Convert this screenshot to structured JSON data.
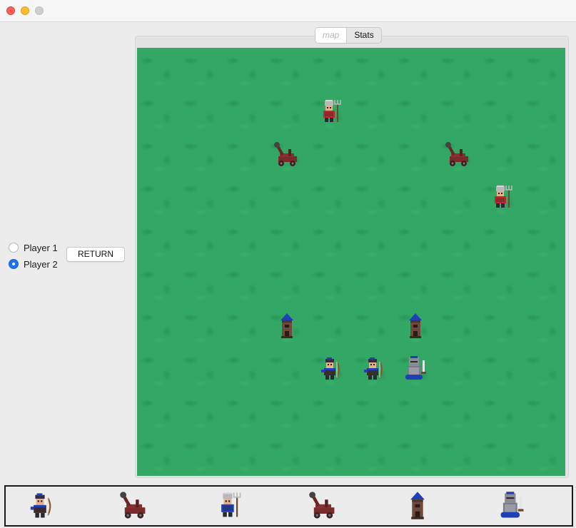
{
  "window": {
    "controls": [
      "close",
      "minimize",
      "maximize"
    ]
  },
  "sidebar": {
    "players": [
      {
        "label": "Player 1",
        "selected": false
      },
      {
        "label": "Player 2",
        "selected": true
      }
    ],
    "return_label": "RETURN"
  },
  "tabs": [
    {
      "label": "map",
      "active": true
    },
    {
      "label": "Stats",
      "active": false
    }
  ],
  "map": {
    "grid": {
      "cols": 10,
      "rows": 10
    },
    "terrain_color": "#33a765",
    "units": [
      {
        "type": "pitchfork-peasant",
        "team": "red",
        "col": 4,
        "row": 1
      },
      {
        "type": "catapult",
        "team": "red",
        "col": 3,
        "row": 2
      },
      {
        "type": "catapult",
        "team": "red",
        "col": 7,
        "row": 2
      },
      {
        "type": "pitchfork-peasant",
        "team": "red",
        "col": 8,
        "row": 3
      },
      {
        "type": "tower",
        "team": "blue",
        "col": 3,
        "row": 6
      },
      {
        "type": "tower",
        "team": "blue",
        "col": 6,
        "row": 6
      },
      {
        "type": "archer",
        "team": "blue",
        "col": 4,
        "row": 7
      },
      {
        "type": "archer",
        "team": "blue",
        "col": 5,
        "row": 7
      },
      {
        "type": "knight",
        "team": "blue",
        "col": 6,
        "row": 7
      }
    ]
  },
  "unit_tray": [
    {
      "type": "archer",
      "team": "blue"
    },
    {
      "type": "catapult",
      "team": "blue"
    },
    {
      "type": "pitchfork-peasant",
      "team": "blue"
    },
    {
      "type": "catapult",
      "team": "blue"
    },
    {
      "type": "tower",
      "team": "blue"
    },
    {
      "type": "knight",
      "team": "blue"
    }
  ],
  "colors": {
    "team_red": "#c0282d",
    "team_blue": "#1f3fb4",
    "accent": "#1a74f2"
  }
}
